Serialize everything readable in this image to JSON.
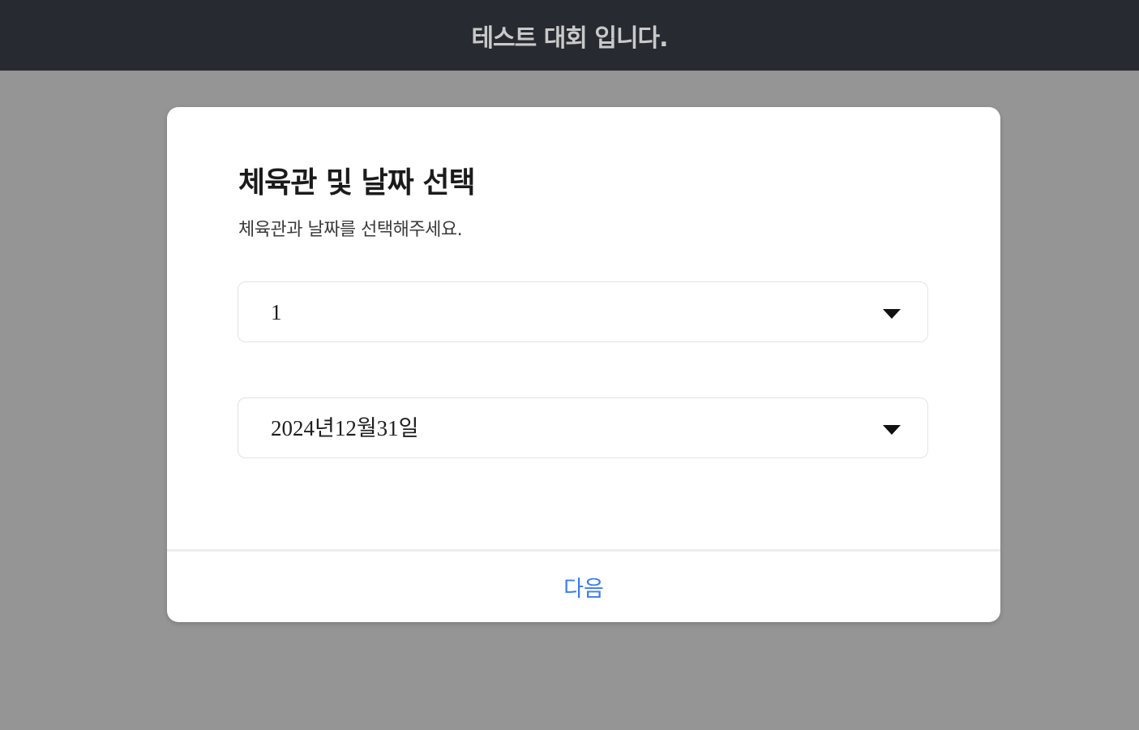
{
  "header": {
    "title": "테스트 대회 입니다."
  },
  "modal": {
    "title": "체육관 및 날짜 선택",
    "subtitle": "체육관과 날짜를 선택해주세요.",
    "gym_select": {
      "value": "1",
      "icon": "caret-down-icon"
    },
    "date_select": {
      "value": "2024년12월31일",
      "icon": "caret-down-icon"
    },
    "next_label": "다음"
  },
  "colors": {
    "header_bg": "#272a30",
    "overlay_bg": "#959595",
    "accent": "#3b7bf0"
  }
}
